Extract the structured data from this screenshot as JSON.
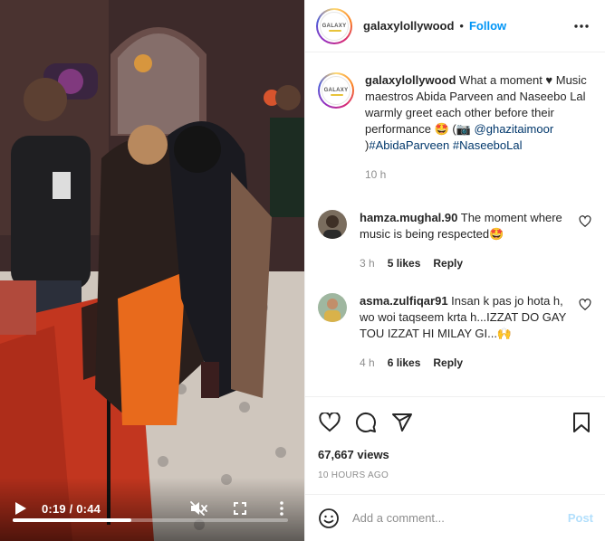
{
  "video": {
    "time_display": "0:19 / 0:44",
    "progress": 0.43,
    "icons": [
      "play-icon",
      "muted-speaker-icon",
      "fullscreen-icon",
      "more-vertical-icon"
    ]
  },
  "post": {
    "username": "galaxylollywood",
    "follow_label": "Follow",
    "separator": "•",
    "avatar_text": "GALAXY",
    "caption": {
      "username": "galaxylollywood",
      "text": "What a moment ♥ Music maestros Abida Parveen and Naseebo Lal warmly greet each other before their performance 🤩 (📷",
      "mention": "@ghazitaimoor",
      "close": ")",
      "hashtag1": "#AbidaParveen",
      "hashtag2": "#NaseeboLal",
      "time": "10 h"
    },
    "comments": [
      {
        "username": "hamza.mughal.90",
        "text": "The moment where music is being respected🤩",
        "time": "3 h",
        "likes": "5 likes",
        "reply": "Reply"
      },
      {
        "username": "asma.zulfiqar91",
        "text": "Insan k pas jo hota h, wo woi taqseem krta h...IZZAT DO GAY TOU IZZAT HI MILAY GI...🙌",
        "time": "4 h",
        "likes": "6 likes",
        "reply": "Reply"
      }
    ],
    "views": "67,667 views",
    "timeago": "10 HOURS AGO"
  },
  "comment_box": {
    "placeholder": "Add a comment...",
    "post_label": "Post"
  },
  "colors": {
    "follow": "#0095f6",
    "post_disabled": "#b2dffc",
    "muted_text": "#8e8e8e",
    "link": "#00376b"
  }
}
